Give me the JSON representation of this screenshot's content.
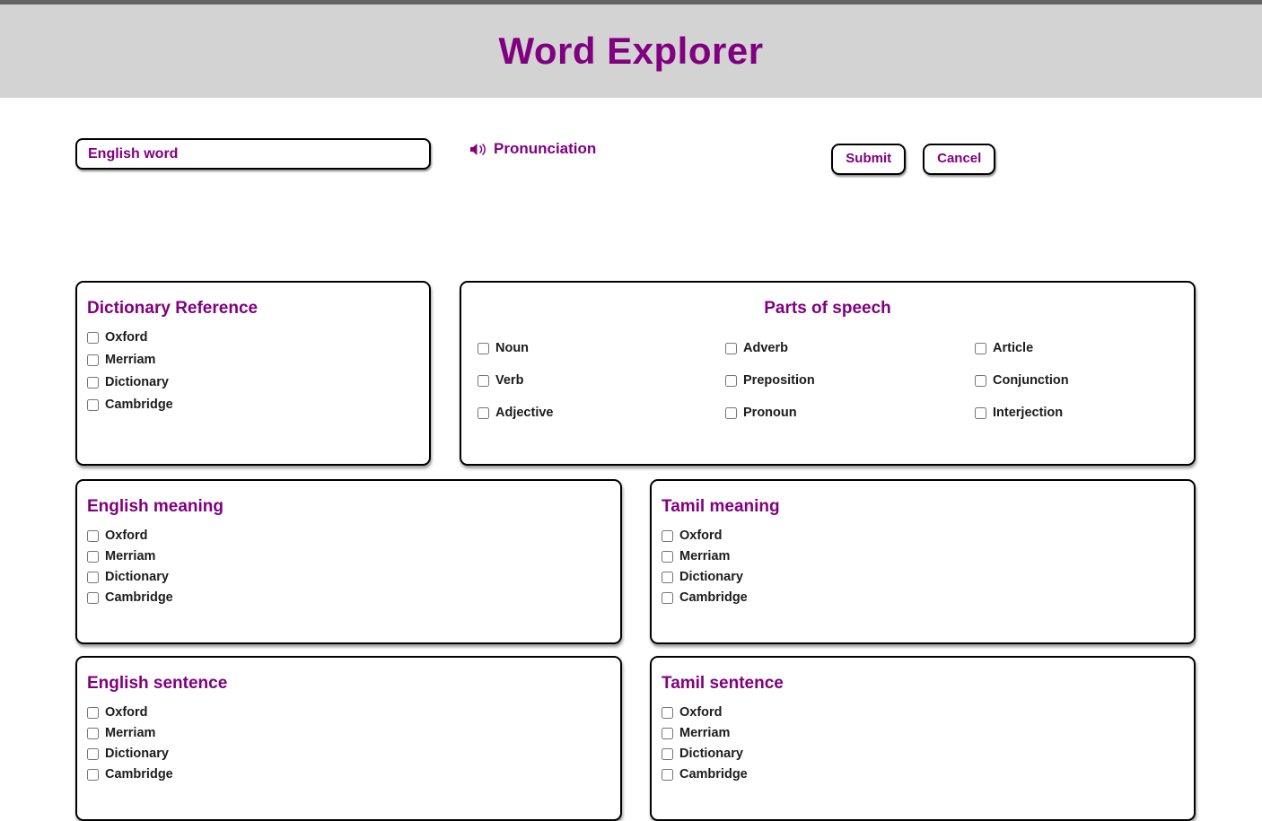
{
  "header": {
    "title": "Word Explorer"
  },
  "controls": {
    "word_input": {
      "placeholder": "English word",
      "value": ""
    },
    "pronunciation": {
      "label": "Pronunciation",
      "icon": "speaker-icon"
    },
    "submit_label": "Submit",
    "cancel_label": "Cancel"
  },
  "panels": {
    "dictionary_reference": {
      "title": "Dictionary Reference",
      "options": [
        "Oxford",
        "Merriam",
        "Dictionary",
        "Cambridge"
      ]
    },
    "parts_of_speech": {
      "title": "Parts of speech",
      "column1": [
        "Noun",
        "Verb",
        "Adjective"
      ],
      "column2": [
        "Adverb",
        "Preposition",
        "Pronoun"
      ],
      "column3": [
        "Article",
        "Conjunction",
        "Interjection"
      ]
    },
    "english_meaning": {
      "title": "English meaning",
      "options": [
        "Oxford",
        "Merriam",
        "Dictionary",
        "Cambridge"
      ]
    },
    "tamil_meaning": {
      "title": "Tamil meaning",
      "options": [
        "Oxford",
        "Merriam",
        "Dictionary",
        "Cambridge"
      ]
    },
    "english_sentence": {
      "title": "English sentence",
      "options": [
        "Oxford",
        "Merriam",
        "Dictionary",
        "Cambridge"
      ]
    },
    "tamil_sentence": {
      "title": "Tamil sentence",
      "options": [
        "Oxford",
        "Merriam",
        "Dictionary",
        "Cambridge"
      ]
    }
  },
  "colors": {
    "accent_purple": "#800080",
    "header_background": "#d3d3d3",
    "top_strip": "#636363",
    "border": "#000000"
  }
}
